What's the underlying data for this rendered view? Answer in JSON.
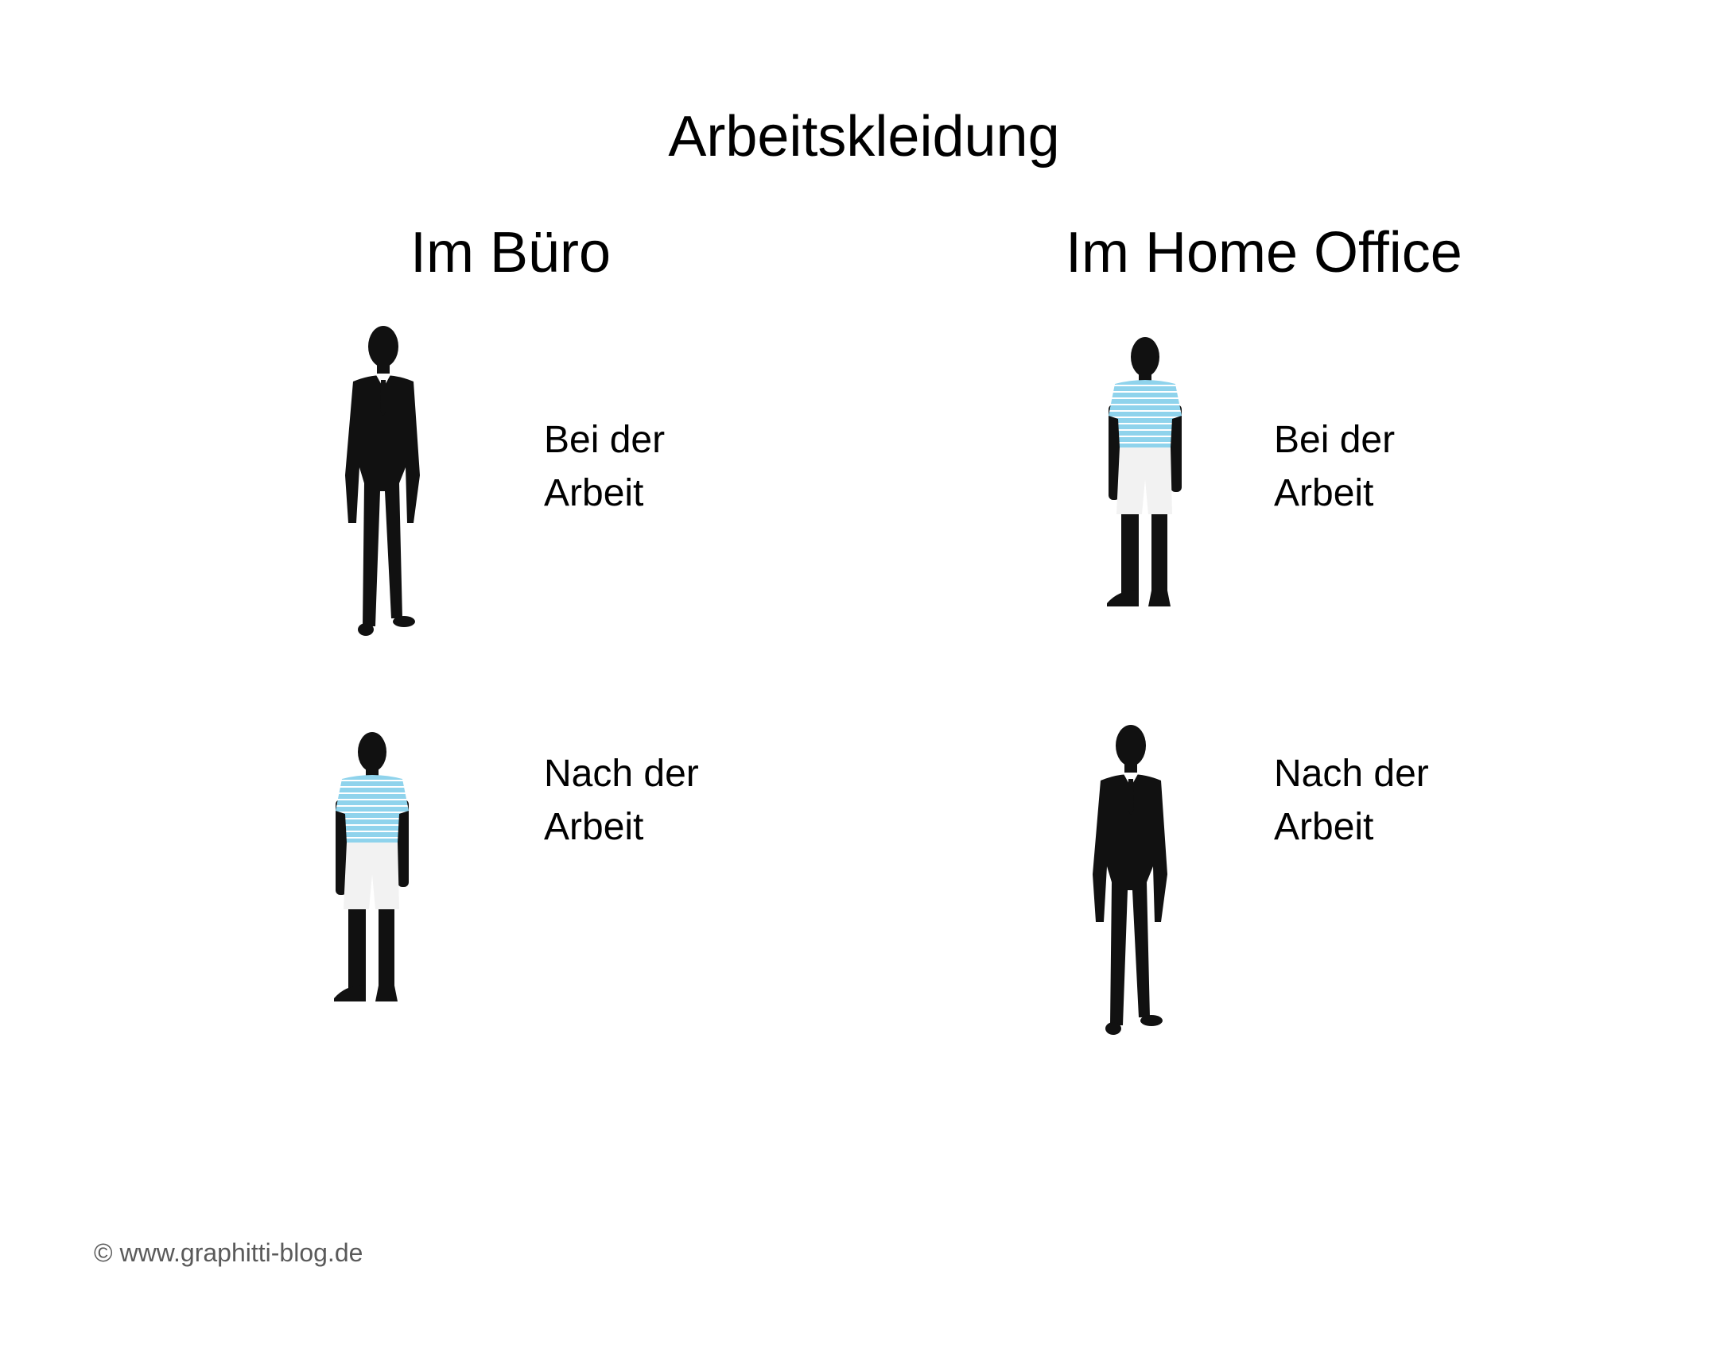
{
  "title": "Arbeitskleidung",
  "columns": [
    {
      "heading": "Im Büro",
      "rows": [
        {
          "line1": "Bei der",
          "line2": "Arbeit",
          "outfit": "suit-figure-icon"
        },
        {
          "line1": "Nach der",
          "line2": "Arbeit",
          "outfit": "casual-figure-icon"
        }
      ]
    },
    {
      "heading": "Im Home Office",
      "rows": [
        {
          "line1": "Bei der",
          "line2": "Arbeit",
          "outfit": "casual-figure-icon"
        },
        {
          "line1": "Nach der",
          "line2": "Arbeit",
          "outfit": "suit-figure-icon"
        }
      ]
    }
  ],
  "footer": "© www.graphitti-blog.de",
  "colors": {
    "shirt": "#8fd3ec",
    "stripes": "#ffffff",
    "silhouette": "#111111",
    "shorts": "#f2f2f2"
  }
}
